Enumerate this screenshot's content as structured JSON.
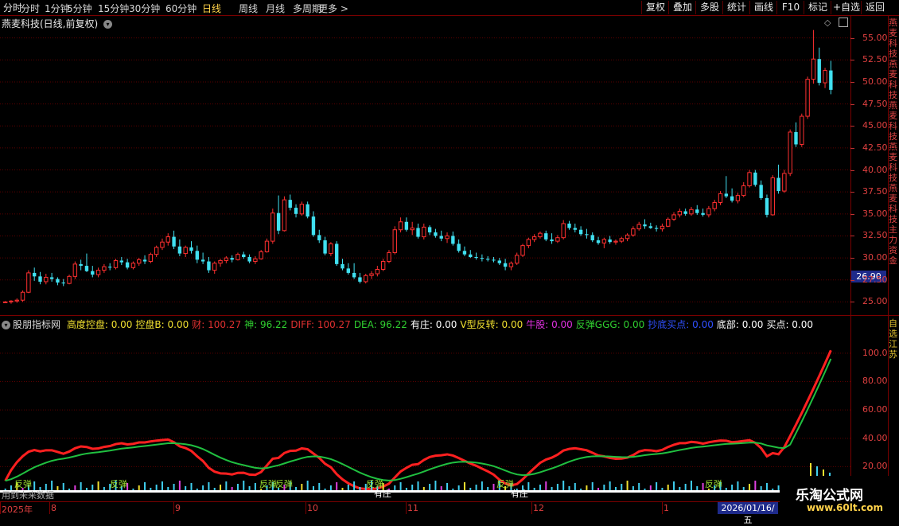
{
  "toolbar": {
    "periods": [
      "分时",
      "1分钟",
      "5分钟",
      "15分钟",
      "30分钟",
      "60分钟",
      "日线",
      "周线",
      "月线",
      "多周期",
      "更多"
    ],
    "active_period": "日线",
    "right_buttons": [
      "复权",
      "叠加",
      "多股",
      "统计",
      "画线",
      "F10",
      "标记",
      "+自选",
      "返回"
    ]
  },
  "chart_title": "燕麦科技(日线,前复权)",
  "price_axis": [
    "55.00",
    "52.50",
    "50.00",
    "47.50",
    "45.00",
    "42.50",
    "40.00",
    "37.50",
    "35.00",
    "32.50",
    "30.00",
    "27.50",
    "25.00"
  ],
  "last_price": "26.90",
  "indicator_axis": [
    "100.0",
    "80.00",
    "60.00",
    "40.00",
    "20.00"
  ],
  "indicator": {
    "name": "股朋指标网",
    "fields": [
      {
        "label": "高度控盘: 0.00",
        "color": "#f0e030"
      },
      {
        "label": "控盘B: 0.00",
        "color": "#f0e030"
      },
      {
        "label": "财: 100.27",
        "color": "#e03030"
      },
      {
        "label": "神: 96.22",
        "color": "#30d030"
      },
      {
        "label": "DIFF: 100.27",
        "color": "#e03030"
      },
      {
        "label": "DEA: 96.22",
        "color": "#30d030"
      },
      {
        "label": "有庄: 0.00",
        "color": "#ffffff"
      },
      {
        "label": "V型反转: 0.00",
        "color": "#f0e030"
      },
      {
        "label": "牛股: 0.00",
        "color": "#e030e0"
      },
      {
        "label": "反弹GGG: 0.00",
        "color": "#30d030"
      },
      {
        "label": "抄底买点: 0.00",
        "color": "#3050ff"
      },
      {
        "label": "底部: 0.00",
        "color": "#ffffff"
      },
      {
        "label": "买点: 0.00",
        "color": "#ffffff"
      }
    ]
  },
  "signals": {
    "rebound": "反弹",
    "zhuang": "有庄"
  },
  "future_text": "用到未来数据",
  "right_vertical_text": "燕麦科技燕麦科技燕麦科技燕麦科技燕麦科技主力资金",
  "right_vertical_text2": "自选 江苏",
  "x_axis": {
    "labels": [
      "2025年",
      "8",
      "9",
      "10",
      "11",
      "12",
      "1"
    ],
    "current_date": "2026/01/16/五"
  },
  "watermark": {
    "main": "乐淘公式网",
    "url": "www.60lt.com"
  },
  "colors": {
    "up": "#ff3030",
    "down": "#40e0f0",
    "grid": "#5c0000",
    "border": "#7a0000"
  },
  "chart_data": {
    "type": "candlestick",
    "title": "燕麦科技(日线,前复权)",
    "ylim": [
      23.5,
      57.5
    ],
    "candles": [
      [
        25.0,
        25.1,
        24.9,
        25.0
      ],
      [
        25.0,
        25.2,
        24.8,
        25.1
      ],
      [
        25.1,
        25.4,
        24.9,
        25.2
      ],
      [
        25.2,
        26.3,
        25.0,
        26.1
      ],
      [
        26.1,
        28.6,
        26.0,
        28.3
      ],
      [
        28.3,
        28.9,
        27.4,
        27.9
      ],
      [
        27.9,
        28.4,
        27.0,
        27.3
      ],
      [
        27.3,
        28.2,
        27.0,
        27.8
      ],
      [
        27.8,
        28.3,
        27.3,
        27.6
      ],
      [
        27.6,
        27.8,
        26.9,
        27.2
      ],
      [
        27.2,
        27.6,
        26.8,
        27.1
      ],
      [
        27.1,
        28.1,
        27.0,
        27.9
      ],
      [
        27.9,
        29.6,
        27.6,
        29.3
      ],
      [
        29.3,
        29.8,
        28.6,
        29.1
      ],
      [
        29.1,
        30.5,
        28.4,
        28.5
      ],
      [
        28.5,
        29.1,
        27.8,
        28.1
      ],
      [
        28.1,
        28.9,
        27.8,
        28.6
      ],
      [
        28.6,
        29.3,
        28.3,
        29.0
      ],
      [
        29.0,
        29.4,
        28.6,
        28.9
      ],
      [
        28.9,
        29.9,
        28.7,
        29.7
      ],
      [
        29.7,
        30.1,
        29.2,
        29.5
      ],
      [
        29.5,
        29.9,
        28.7,
        28.9
      ],
      [
        28.9,
        29.6,
        28.7,
        29.4
      ],
      [
        29.4,
        30.0,
        29.1,
        29.8
      ],
      [
        29.8,
        30.3,
        29.3,
        29.6
      ],
      [
        29.6,
        30.6,
        29.4,
        30.4
      ],
      [
        30.4,
        31.4,
        30.1,
        31.2
      ],
      [
        31.2,
        32.2,
        30.9,
        31.8
      ],
      [
        31.8,
        32.8,
        31.4,
        32.4
      ],
      [
        32.4,
        33.1,
        31.0,
        31.3
      ],
      [
        31.3,
        32.1,
        30.2,
        30.5
      ],
      [
        30.5,
        31.4,
        30.1,
        31.2
      ],
      [
        31.2,
        31.9,
        30.5,
        30.8
      ],
      [
        30.8,
        31.4,
        29.4,
        29.8
      ],
      [
        29.8,
        30.6,
        29.3,
        29.6
      ],
      [
        29.6,
        30.1,
        28.3,
        28.6
      ],
      [
        28.6,
        29.6,
        28.2,
        29.4
      ],
      [
        29.4,
        29.9,
        29.0,
        29.7
      ],
      [
        29.7,
        30.2,
        29.4,
        30.0
      ],
      [
        30.0,
        30.3,
        29.5,
        29.8
      ],
      [
        29.8,
        30.6,
        29.7,
        30.4
      ],
      [
        30.4,
        30.7,
        29.9,
        30.1
      ],
      [
        30.1,
        30.4,
        29.4,
        29.6
      ],
      [
        29.6,
        30.2,
        29.3,
        29.9
      ],
      [
        29.9,
        30.9,
        29.8,
        30.7
      ],
      [
        30.7,
        32.2,
        30.6,
        31.9
      ],
      [
        31.9,
        35.6,
        31.6,
        35.1
      ],
      [
        35.1,
        37.1,
        32.7,
        33.1
      ],
      [
        33.1,
        37.0,
        33.0,
        36.6
      ],
      [
        36.6,
        37.2,
        35.4,
        35.7
      ],
      [
        35.7,
        36.1,
        34.6,
        35.0
      ],
      [
        35.0,
        36.4,
        34.8,
        36.1
      ],
      [
        36.1,
        36.4,
        34.5,
        34.7
      ],
      [
        34.7,
        35.3,
        32.4,
        32.6
      ],
      [
        32.6,
        33.2,
        31.7,
        32.0
      ],
      [
        32.0,
        32.4,
        30.3,
        30.5
      ],
      [
        30.5,
        31.8,
        30.2,
        31.6
      ],
      [
        31.6,
        31.9,
        29.1,
        29.3
      ],
      [
        29.3,
        29.9,
        28.6,
        28.8
      ],
      [
        28.8,
        29.4,
        28.1,
        28.3
      ],
      [
        28.3,
        29.4,
        27.6,
        27.8
      ],
      [
        27.8,
        28.3,
        27.1,
        27.3
      ],
      [
        27.3,
        28.2,
        27.1,
        28.0
      ],
      [
        28.0,
        28.5,
        27.6,
        28.2
      ],
      [
        28.2,
        29.1,
        27.9,
        28.7
      ],
      [
        28.7,
        29.9,
        28.5,
        29.6
      ],
      [
        29.6,
        30.9,
        29.4,
        30.6
      ],
      [
        30.6,
        33.6,
        30.4,
        33.2
      ],
      [
        33.2,
        34.6,
        32.9,
        34.1
      ],
      [
        34.1,
        34.6,
        33.0,
        33.2
      ],
      [
        33.2,
        34.1,
        32.6,
        33.4
      ],
      [
        33.4,
        33.9,
        32.2,
        32.4
      ],
      [
        32.4,
        33.9,
        32.1,
        33.5
      ],
      [
        33.5,
        33.7,
        32.6,
        32.9
      ],
      [
        32.9,
        33.3,
        32.3,
        32.5
      ],
      [
        32.5,
        33.1,
        31.9,
        32.2
      ],
      [
        32.2,
        32.9,
        31.7,
        32.5
      ],
      [
        32.5,
        33.0,
        31.4,
        31.6
      ],
      [
        31.6,
        32.1,
        30.6,
        30.8
      ],
      [
        30.8,
        31.3,
        30.2,
        30.4
      ],
      [
        30.4,
        30.9,
        30.0,
        30.1
      ],
      [
        30.1,
        30.6,
        29.8,
        30.0
      ],
      [
        30.0,
        30.4,
        29.6,
        29.9
      ],
      [
        29.9,
        30.2,
        29.6,
        29.8
      ],
      [
        29.8,
        30.1,
        29.5,
        29.7
      ],
      [
        29.7,
        30.0,
        29.2,
        29.4
      ],
      [
        29.4,
        29.9,
        28.6,
        29.0
      ],
      [
        29.0,
        29.6,
        28.6,
        29.4
      ],
      [
        29.4,
        30.6,
        29.2,
        30.3
      ],
      [
        30.3,
        31.6,
        30.1,
        31.4
      ],
      [
        31.4,
        32.3,
        31.1,
        32.1
      ],
      [
        32.1,
        32.7,
        31.8,
        32.4
      ],
      [
        32.4,
        33.0,
        32.2,
        32.8
      ],
      [
        32.8,
        33.1,
        31.9,
        32.1
      ],
      [
        32.1,
        32.8,
        31.6,
        31.9
      ],
      [
        31.9,
        32.6,
        31.7,
        32.3
      ],
      [
        32.3,
        34.3,
        32.1,
        33.9
      ],
      [
        33.9,
        34.2,
        33.2,
        33.4
      ],
      [
        33.4,
        33.9,
        32.9,
        33.2
      ],
      [
        33.2,
        33.6,
        32.5,
        32.7
      ],
      [
        32.7,
        33.3,
        32.2,
        32.6
      ],
      [
        32.6,
        32.9,
        31.8,
        32.0
      ],
      [
        32.0,
        32.4,
        31.5,
        31.7
      ],
      [
        31.7,
        32.3,
        31.1,
        32.1
      ],
      [
        32.1,
        32.5,
        31.6,
        31.8
      ],
      [
        31.8,
        32.1,
        31.5,
        31.9
      ],
      [
        31.9,
        32.4,
        31.7,
        32.2
      ],
      [
        32.2,
        32.8,
        31.9,
        32.6
      ],
      [
        32.6,
        33.6,
        32.4,
        33.3
      ],
      [
        33.3,
        34.1,
        33.1,
        33.8
      ],
      [
        33.8,
        34.4,
        33.3,
        33.6
      ],
      [
        33.6,
        34.0,
        33.3,
        33.4
      ],
      [
        33.4,
        33.7,
        33.0,
        33.3
      ],
      [
        33.3,
        33.9,
        33.0,
        33.6
      ],
      [
        33.6,
        34.6,
        33.5,
        34.4
      ],
      [
        34.4,
        35.2,
        34.2,
        34.9
      ],
      [
        34.9,
        35.6,
        34.6,
        35.3
      ],
      [
        35.3,
        35.6,
        34.8,
        35.0
      ],
      [
        35.0,
        35.8,
        34.8,
        35.5
      ],
      [
        35.5,
        36.0,
        34.9,
        35.1
      ],
      [
        35.1,
        35.6,
        34.7,
        34.9
      ],
      [
        34.9,
        35.9,
        34.6,
        35.6
      ],
      [
        35.6,
        36.6,
        35.3,
        36.3
      ],
      [
        36.3,
        37.6,
        36.0,
        37.3
      ],
      [
        37.3,
        39.3,
        36.8,
        37.0
      ],
      [
        37.0,
        37.9,
        36.3,
        36.5
      ],
      [
        36.5,
        37.4,
        36.2,
        37.1
      ],
      [
        37.1,
        38.6,
        36.9,
        38.2
      ],
      [
        38.2,
        40.0,
        38.0,
        39.7
      ],
      [
        39.7,
        40.0,
        38.1,
        38.3
      ],
      [
        38.3,
        38.8,
        36.6,
        36.8
      ],
      [
        36.8,
        37.2,
        34.6,
        34.9
      ],
      [
        34.9,
        39.4,
        34.8,
        39.1
      ],
      [
        39.1,
        40.6,
        37.3,
        37.6
      ],
      [
        37.6,
        40.0,
        37.4,
        39.6
      ],
      [
        39.6,
        44.6,
        39.3,
        44.3
      ],
      [
        44.3,
        45.4,
        42.6,
        42.9
      ],
      [
        42.9,
        46.4,
        42.6,
        46.1
      ],
      [
        46.1,
        50.6,
        45.8,
        50.3
      ],
      [
        50.3,
        55.9,
        49.8,
        52.6
      ],
      [
        52.6,
        53.9,
        49.6,
        49.9
      ],
      [
        49.9,
        51.6,
        49.3,
        51.3
      ],
      [
        51.3,
        52.4,
        48.6,
        49.1
      ]
    ]
  }
}
